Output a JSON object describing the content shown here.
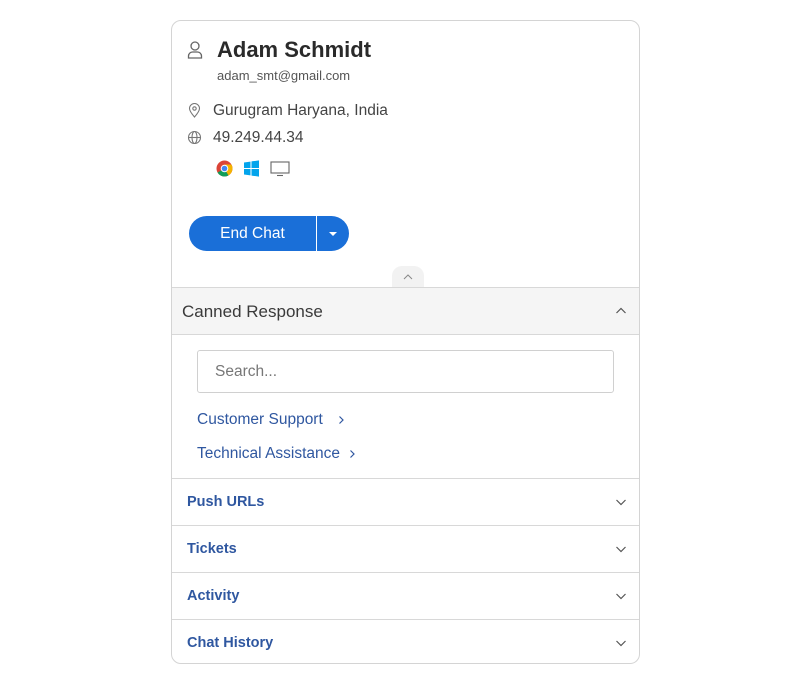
{
  "profile": {
    "name": "Adam Schmidt",
    "email": "adam_smt@gmail.com",
    "location": "Gurugram Haryana, India",
    "ip": "49.249.44.34",
    "environment_icons": [
      "chrome-icon",
      "windows-icon",
      "desktop-icon"
    ]
  },
  "actions": {
    "end_chat_label": "End Chat",
    "primary_color": "#1a6fd8"
  },
  "canned_response": {
    "title": "Canned Response",
    "search_placeholder": "Search...",
    "categories": [
      {
        "label": "Customer Support"
      },
      {
        "label": "Technical Assistance"
      }
    ]
  },
  "accordion": [
    {
      "label": "Push URLs"
    },
    {
      "label": "Tickets"
    },
    {
      "label": "Activity"
    },
    {
      "label": "Chat History"
    }
  ],
  "colors": {
    "link": "#2f57a0",
    "border": "#d8d8d8"
  }
}
